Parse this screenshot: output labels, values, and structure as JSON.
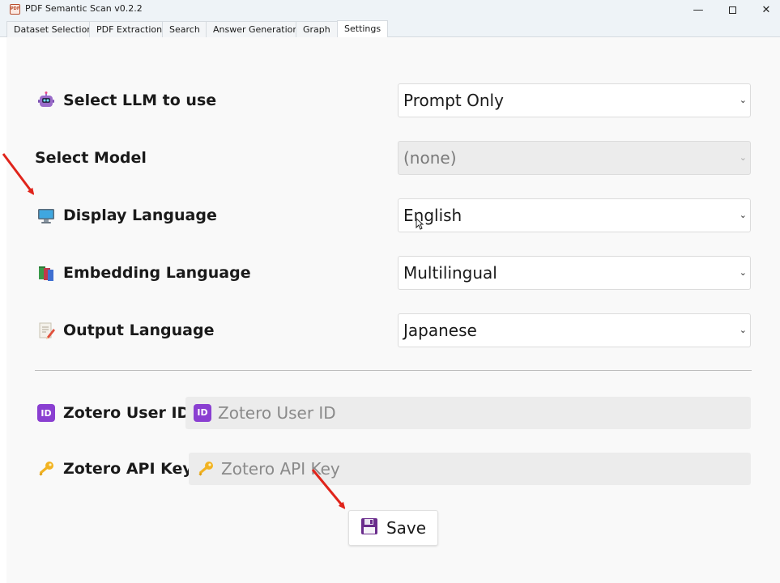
{
  "window": {
    "title": "PDF Semantic Scan v0.2.2",
    "app_icon_text": "PDF",
    "minimize": "—",
    "close": "✕"
  },
  "tabs": [
    {
      "label": "Dataset Selection"
    },
    {
      "label": "PDF Extraction"
    },
    {
      "label": "Search"
    },
    {
      "label": "Answer Generation"
    },
    {
      "label": "Graph"
    },
    {
      "label": "Settings",
      "active": true
    }
  ],
  "settings": {
    "llm": {
      "label": "Select LLM to use",
      "icon": "robot-icon",
      "value": "Prompt Only"
    },
    "model": {
      "label": "Select Model",
      "value": "(none)",
      "disabled": true
    },
    "display_language": {
      "label": "Display Language",
      "icon": "monitor-icon",
      "value": "English"
    },
    "embedding_language": {
      "label": "Embedding Language",
      "icon": "books-icon",
      "value": "Multilingual"
    },
    "output_language": {
      "label": "Output Language",
      "icon": "memo-icon",
      "value": "Japanese"
    }
  },
  "zotero": {
    "user_id": {
      "label": "Zotero User ID",
      "icon": "id-icon",
      "placeholder": "Zotero User ID"
    },
    "api_key": {
      "label": "Zotero API Key",
      "icon": "key-icon",
      "placeholder": "Zotero API Key"
    }
  },
  "save_button": {
    "label": "Save",
    "icon": "floppy-disk-icon"
  },
  "colors": {
    "annotation_arrow": "#e0241b",
    "id_icon": "#8a3fd1",
    "key_icon": "#f2b322",
    "floppy_icon": "#6a2c8c"
  }
}
